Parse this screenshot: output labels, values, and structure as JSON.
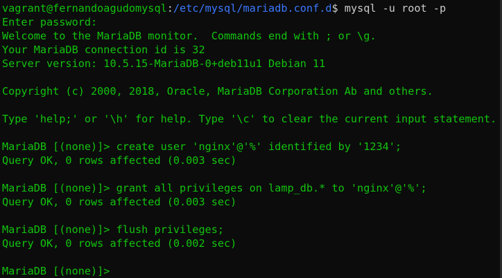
{
  "colors": {
    "background": "#0c0c0c",
    "output_text": "#13c40f",
    "path": "#3b78ff",
    "command_text": "#cccccc"
  },
  "prompt": {
    "user_host": "vagrant@fernandoagudomysql",
    "separator": ":",
    "path": "/etc/mysql/mariadb.conf.d",
    "symbol": "$",
    "command": " mysql -u root -p"
  },
  "lines": [
    "Enter password:",
    "Welcome to the MariaDB monitor.  Commands end with ; or \\g.",
    "Your MariaDB connection id is 32",
    "Server version: 10.5.15-MariaDB-0+deb11u1 Debian 11",
    "",
    "Copyright (c) 2000, 2018, Oracle, MariaDB Corporation Ab and others.",
    "",
    "Type 'help;' or '\\h' for help. Type '\\c' to clear the current input statement.",
    "",
    "MariaDB [(none)]> create user 'nginx'@'%' identified by '1234';",
    "Query OK, 0 rows affected (0.003 sec)",
    "",
    "MariaDB [(none)]> grant all privileges on lamp_db.* to 'nginx'@'%';",
    "Query OK, 0 rows affected (0.003 sec)",
    "",
    "MariaDB [(none)]> flush privileges;",
    "Query OK, 0 rows affected (0.002 sec)",
    "",
    "MariaDB [(none)]>"
  ]
}
